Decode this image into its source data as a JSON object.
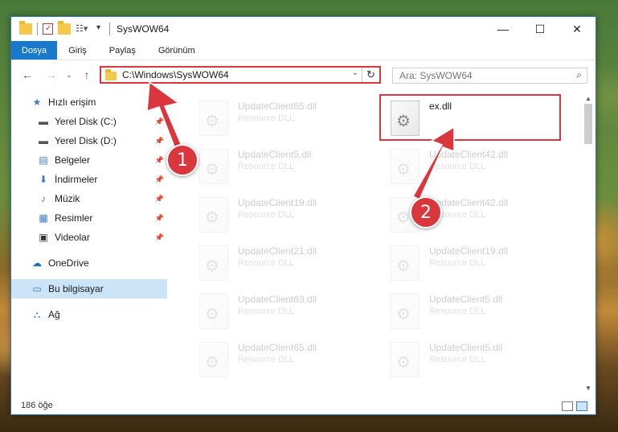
{
  "window": {
    "title": "SysWOW64",
    "minimize": "—",
    "maximize": "☐",
    "close": "✕"
  },
  "ribbon": {
    "tabs": [
      "Dosya",
      "Giriş",
      "Paylaş",
      "Görünüm"
    ]
  },
  "address": {
    "path": "C:\\Windows\\SysWOW64",
    "search_placeholder": "Ara: SysWOW64"
  },
  "sidebar": {
    "items": [
      {
        "label": "Hızlı erişim",
        "icon": "star-icon"
      },
      {
        "label": "Yerel Disk (C:)",
        "icon": "drive-icon",
        "pinned": true
      },
      {
        "label": "Yerel Disk (D:)",
        "icon": "drive-icon",
        "pinned": true
      },
      {
        "label": "Belgeler",
        "icon": "document-icon",
        "pinned": true
      },
      {
        "label": "İndirmeler",
        "icon": "download-icon",
        "pinned": true
      },
      {
        "label": "Müzik",
        "icon": "music-icon",
        "pinned": true
      },
      {
        "label": "Resimler",
        "icon": "pictures-icon",
        "pinned": true
      },
      {
        "label": "Videolar",
        "icon": "video-icon",
        "pinned": true
      },
      {
        "label": "OneDrive",
        "icon": "cloud-icon"
      },
      {
        "label": "Bu bilgisayar",
        "icon": "computer-icon",
        "selected": true
      },
      {
        "label": "Ağ",
        "icon": "network-icon"
      }
    ]
  },
  "files": [
    {
      "name": "UpdateClient65.dll",
      "type": "Resource DLL"
    },
    {
      "name": "ex.dll",
      "type": ""
    },
    {
      "name": "UpdateClient5.dll",
      "type": "Resource DLL"
    },
    {
      "name": "UpdateClient42.dll",
      "type": "Resource DLL"
    },
    {
      "name": "UpdateClient19.dll",
      "type": "Resource DLL"
    },
    {
      "name": "UpdateClient42.dll",
      "type": "Resource DLL"
    },
    {
      "name": "UpdateClient21.dll",
      "type": "Resource DLL"
    },
    {
      "name": "UpdateClient19.dll",
      "type": "Resource DLL"
    },
    {
      "name": "UpdateClient63.dll",
      "type": "Resource DLL"
    },
    {
      "name": "UpdateClient5.dll",
      "type": "Resource DLL"
    },
    {
      "name": "UpdateClient65.dll",
      "type": "Resource DLL"
    },
    {
      "name": "UpdateClient5.dll",
      "type": "Resource DLL"
    }
  ],
  "status": {
    "count": "186 öğe"
  },
  "annotations": {
    "step1": "1",
    "step2": "2",
    "color": "#d9363e"
  }
}
